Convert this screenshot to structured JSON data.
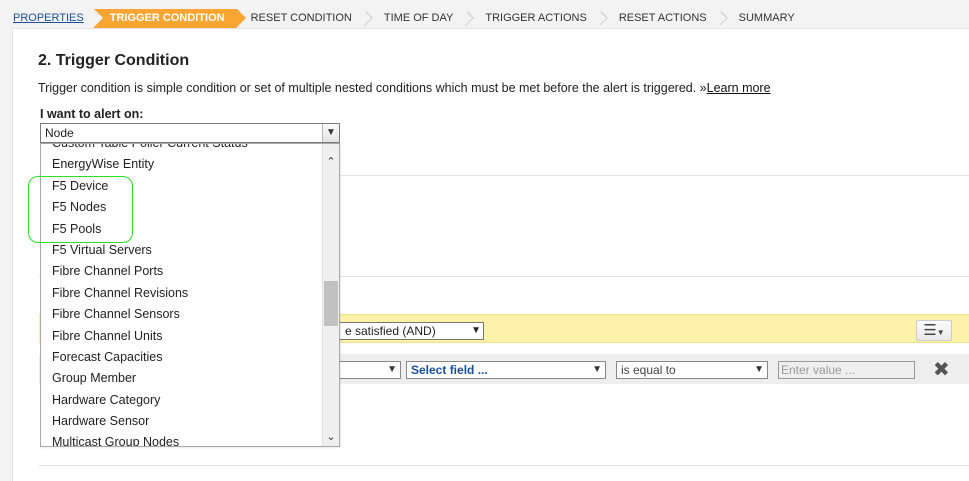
{
  "wizard": {
    "steps": [
      "PROPERTIES",
      "TRIGGER CONDITION",
      "RESET CONDITION",
      "TIME OF DAY",
      "TRIGGER ACTIONS",
      "RESET ACTIONS",
      "SUMMARY"
    ]
  },
  "section": {
    "title": "2. Trigger Condition",
    "description": "Trigger condition is simple condition or set of multiple nested conditions which must be met before the alert is triggered. »",
    "learn_more": "Learn more",
    "alert_label": "I want to alert on:",
    "selected_value": "Node"
  },
  "dropdown": {
    "items": [
      "Custom Table Poller Current Status",
      "EnergyWise Entity",
      "F5 Device",
      "F5 Nodes",
      "F5 Pools",
      "F5 Virtual Servers",
      "Fibre Channel Ports",
      "Fibre Channel Revisions",
      "Fibre Channel Sensors",
      "Fibre Channel Units",
      "Forecast Capacities",
      "Group Member",
      "Hardware Category",
      "Hardware Sensor",
      "Multicast Group Nodes"
    ]
  },
  "condition": {
    "logic_select": "e satisfied (AND)",
    "field_select": "Select field ...",
    "operator_select": "is equal to",
    "value_placeholder": "Enter value ..."
  },
  "colors": {
    "active_step": "#f8a531",
    "highlight": "#2adf2a",
    "condition_bar": "#fdf2a8"
  },
  "icons": {
    "dropdown_arrow": "chevron-down-icon",
    "menu": "menu-icon",
    "remove": "close-icon"
  }
}
